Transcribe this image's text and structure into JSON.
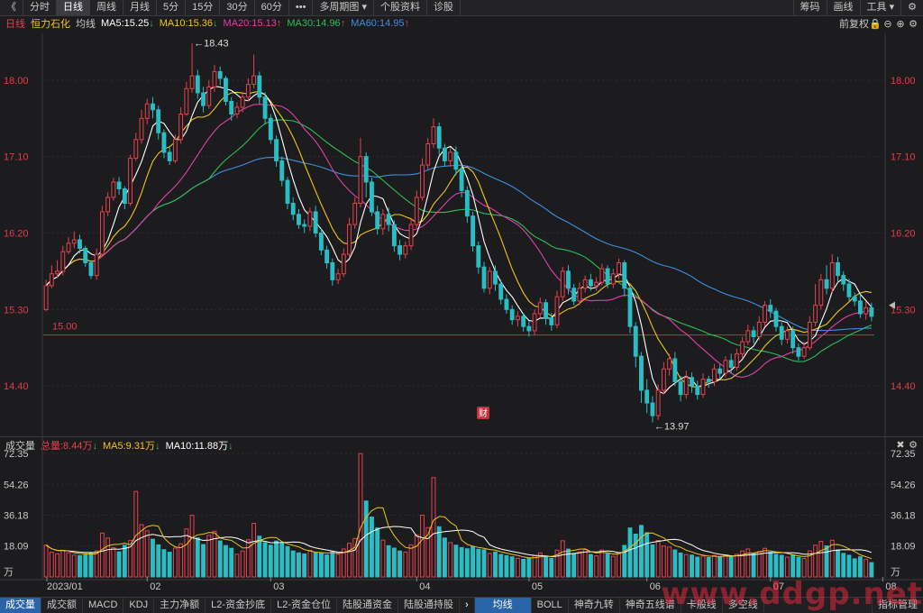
{
  "topbar": {
    "collapse_glyph": "《",
    "periods": [
      "分时",
      "日线",
      "周线",
      "月线",
      "5分",
      "15分",
      "30分",
      "60分"
    ],
    "active_period": 1,
    "more_glyph": "•••",
    "multi_period": "多周期图",
    "stock_info": "个股资料",
    "diagnose": "诊股",
    "chips": "筹码",
    "draw": "画线",
    "tools": "工具"
  },
  "ma_line": {
    "period": "日线",
    "stock": "恒力石化",
    "mode": "均线",
    "ma5": "MA5:15.25",
    "ma10": "MA10:15.36",
    "ma20": "MA20:15.13",
    "ma30": "MA30:14.96",
    "ma60": "MA60:14.95",
    "adjust": "前复权"
  },
  "price_axis": {
    "ticks": [
      "18.00",
      "17.10",
      "16.20",
      "15.30",
      "14.40"
    ],
    "high_label": "18.43",
    "low_label": "13.97",
    "ref_line_label": "15.00",
    "fin_marker": "财"
  },
  "volume_line": {
    "title": "成交量",
    "total": "总量:8.44万",
    "ma5": "MA5:9.31万",
    "ma10": "MA10:11.88万"
  },
  "volume_axis": {
    "ticks": [
      "72.35",
      "54.26",
      "36.18",
      "18.09"
    ],
    "unit": "万"
  },
  "x_axis": {
    "labels": [
      "2023/01",
      "02",
      "03",
      "04",
      "05",
      "06",
      "07",
      "08"
    ]
  },
  "bottom_tabs": {
    "left": [
      "成交量",
      "成交额",
      "MACD",
      "KDJ",
      "主力净额",
      "L2-资金抄底",
      "L2-资金仓位",
      "陆股通资金",
      "陆股通持股"
    ],
    "right": [
      "均线",
      "BOLL",
      "神奇九转",
      "神奇五线谱",
      "卡般线",
      "多空线"
    ],
    "manage": "指标管理",
    "active_left": 0,
    "active_right": 0
  },
  "watermark": "www.ddgp.net",
  "colors": {
    "up": "#e8404e",
    "down": "#2bbdc4",
    "ma5": "#ffffff",
    "ma10": "#f0c419",
    "ma20": "#e040a8",
    "ma30": "#2dbd5a",
    "ma60": "#3f8fe0",
    "ref_line": "#c0333d",
    "axis_text": "#e23c48"
  },
  "chart_data": {
    "type": "candlestick",
    "ylim": [
      13.85,
      18.55
    ],
    "volume_ylim": [
      0,
      72.35
    ],
    "volume_unit": "万",
    "reference_price": 15.0,
    "x_labels": [
      "2023/01",
      "02",
      "03",
      "04",
      "05",
      "06",
      "07",
      "08"
    ],
    "candles": [
      [
        15.3,
        15.58,
        15.65,
        15.28,
        18.6
      ],
      [
        15.58,
        15.72,
        15.82,
        15.55,
        14.5
      ],
      [
        15.72,
        15.75,
        15.88,
        15.67,
        13.5
      ],
      [
        15.75,
        15.98,
        16.05,
        15.7,
        15.6
      ],
      [
        15.98,
        16.08,
        16.15,
        15.95,
        14.2
      ],
      [
        16.08,
        16.12,
        16.22,
        16.02,
        12.8
      ],
      [
        16.12,
        16.02,
        16.18,
        15.96,
        12.5
      ],
      [
        16.02,
        15.85,
        16.05,
        15.8,
        13.0
      ],
      [
        15.85,
        15.7,
        15.88,
        15.66,
        14.2
      ],
      [
        15.7,
        15.95,
        16.02,
        15.65,
        15.3
      ],
      [
        15.95,
        16.45,
        16.52,
        15.92,
        25.7
      ],
      [
        16.45,
        16.62,
        16.68,
        16.4,
        22.8
      ],
      [
        16.62,
        16.8,
        16.85,
        16.58,
        17.1
      ],
      [
        16.8,
        16.72,
        16.86,
        16.65,
        14.7
      ],
      [
        16.72,
        16.55,
        16.75,
        16.48,
        18.6
      ],
      [
        16.55,
        17.08,
        17.12,
        16.52,
        21.3
      ],
      [
        17.08,
        17.3,
        17.38,
        17.05,
        50.1
      ],
      [
        17.3,
        17.55,
        17.65,
        17.25,
        30.6
      ],
      [
        17.55,
        17.72,
        17.78,
        17.48,
        27.0
      ],
      [
        17.72,
        17.65,
        17.8,
        17.55,
        22.1
      ],
      [
        17.65,
        17.38,
        17.7,
        17.3,
        18.8
      ],
      [
        17.38,
        17.15,
        17.42,
        17.08,
        16.0
      ],
      [
        17.15,
        17.05,
        17.22,
        17.0,
        14.5
      ],
      [
        17.05,
        17.3,
        17.36,
        17.02,
        16.9
      ],
      [
        17.3,
        17.6,
        17.68,
        17.25,
        19.4
      ],
      [
        17.6,
        17.9,
        17.98,
        17.58,
        28.1
      ],
      [
        17.9,
        18.05,
        18.43,
        17.85,
        36.1
      ],
      [
        18.05,
        17.85,
        18.12,
        17.78,
        22.9
      ],
      [
        17.85,
        17.7,
        17.92,
        17.62,
        19.0
      ],
      [
        17.7,
        17.92,
        18.0,
        17.66,
        24.4
      ],
      [
        17.92,
        18.1,
        18.18,
        17.86,
        26.8
      ],
      [
        18.1,
        18.02,
        18.16,
        17.94,
        21.1
      ],
      [
        18.02,
        17.75,
        18.05,
        17.7,
        18.4
      ],
      [
        17.75,
        17.6,
        17.8,
        17.52,
        16.8
      ],
      [
        17.6,
        17.68,
        17.74,
        17.55,
        13.3
      ],
      [
        17.68,
        17.8,
        17.86,
        17.62,
        15.2
      ],
      [
        17.8,
        17.95,
        18.02,
        17.75,
        21.8
      ],
      [
        17.95,
        18.05,
        18.3,
        17.9,
        31.4
      ],
      [
        18.05,
        17.8,
        18.1,
        17.72,
        23.9
      ],
      [
        17.8,
        17.55,
        17.86,
        17.48,
        20.1
      ],
      [
        17.55,
        17.3,
        17.6,
        17.25,
        18.6
      ],
      [
        17.3,
        17.05,
        17.35,
        16.98,
        21.0
      ],
      [
        17.05,
        16.82,
        17.1,
        16.75,
        19.8
      ],
      [
        16.82,
        16.55,
        16.86,
        16.48,
        17.8
      ],
      [
        16.55,
        16.42,
        16.62,
        16.35,
        15.2
      ],
      [
        16.42,
        16.3,
        16.48,
        16.25,
        14.1
      ],
      [
        16.3,
        16.28,
        16.36,
        16.2,
        13.5
      ],
      [
        16.28,
        16.45,
        16.5,
        16.22,
        15.6
      ],
      [
        16.45,
        16.2,
        16.52,
        16.15,
        14.2
      ],
      [
        16.2,
        16.0,
        16.25,
        15.94,
        13.8
      ],
      [
        16.0,
        15.85,
        16.05,
        15.78,
        12.9
      ],
      [
        15.85,
        15.65,
        15.9,
        15.58,
        14.7
      ],
      [
        15.65,
        15.72,
        15.78,
        15.6,
        13.3
      ],
      [
        15.72,
        15.95,
        16.02,
        15.68,
        16.4
      ],
      [
        15.95,
        16.3,
        16.38,
        15.92,
        19.7
      ],
      [
        16.3,
        16.55,
        16.62,
        16.25,
        22.5
      ],
      [
        16.55,
        17.1,
        17.32,
        16.5,
        72.3
      ],
      [
        17.1,
        16.8,
        17.15,
        16.62,
        44.5
      ],
      [
        16.8,
        16.45,
        16.85,
        16.4,
        35.1
      ],
      [
        16.45,
        16.25,
        16.52,
        16.18,
        28.7
      ],
      [
        16.25,
        16.42,
        16.48,
        16.18,
        21.6
      ],
      [
        16.42,
        16.3,
        16.5,
        16.22,
        18.3
      ],
      [
        16.3,
        16.05,
        16.35,
        15.98,
        16.9
      ],
      [
        16.05,
        15.95,
        16.12,
        15.88,
        15.2
      ],
      [
        15.95,
        16.05,
        16.1,
        15.9,
        14.6
      ],
      [
        16.05,
        16.3,
        16.38,
        16.0,
        18.8
      ],
      [
        16.3,
        16.62,
        16.7,
        16.26,
        24.6
      ],
      [
        16.62,
        17.0,
        17.08,
        16.58,
        36.2
      ],
      [
        17.0,
        17.25,
        17.32,
        16.95,
        28.9
      ],
      [
        17.25,
        17.45,
        17.55,
        17.2,
        58.2
      ],
      [
        17.45,
        17.2,
        17.5,
        17.12,
        29.4
      ],
      [
        17.2,
        17.05,
        17.25,
        16.98,
        22.8
      ],
      [
        17.05,
        17.15,
        17.2,
        16.98,
        20.1
      ],
      [
        17.15,
        16.95,
        17.22,
        16.88,
        18.6
      ],
      [
        16.95,
        16.7,
        17.0,
        16.62,
        17.2
      ],
      [
        16.7,
        16.4,
        16.75,
        16.32,
        16.5
      ],
      [
        16.4,
        16.05,
        16.45,
        15.98,
        17.8
      ],
      [
        16.05,
        15.8,
        16.1,
        15.72,
        16.2
      ],
      [
        15.8,
        15.55,
        15.86,
        15.5,
        15.9
      ],
      [
        15.55,
        15.75,
        15.8,
        15.48,
        13.8
      ],
      [
        15.75,
        15.6,
        15.82,
        15.52,
        14.6
      ],
      [
        15.6,
        15.42,
        15.65,
        15.36,
        13.2
      ],
      [
        15.42,
        15.3,
        15.48,
        15.25,
        12.5
      ],
      [
        15.3,
        15.18,
        15.35,
        15.12,
        11.8
      ],
      [
        15.18,
        15.22,
        15.28,
        15.1,
        10.9
      ],
      [
        15.22,
        15.1,
        15.26,
        15.04,
        10.3
      ],
      [
        15.1,
        15.05,
        15.16,
        14.98,
        10.8
      ],
      [
        15.05,
        15.25,
        15.3,
        15.0,
        12.5
      ],
      [
        15.25,
        15.38,
        15.44,
        15.2,
        14.1
      ],
      [
        15.38,
        15.2,
        15.42,
        15.12,
        11.7
      ],
      [
        15.2,
        15.12,
        15.26,
        15.05,
        10.9
      ],
      [
        15.12,
        15.45,
        15.52,
        15.08,
        15.7
      ],
      [
        15.45,
        15.75,
        15.8,
        15.4,
        21.2
      ],
      [
        15.75,
        15.55,
        15.82,
        15.48,
        16.3
      ],
      [
        15.55,
        15.4,
        15.6,
        15.35,
        13.8
      ],
      [
        15.4,
        15.55,
        15.62,
        15.35,
        14.7
      ],
      [
        15.55,
        15.65,
        15.7,
        15.5,
        16.1
      ],
      [
        15.65,
        15.58,
        15.72,
        15.52,
        13.2
      ],
      [
        15.58,
        15.62,
        15.68,
        15.52,
        12.4
      ],
      [
        15.62,
        15.78,
        15.84,
        15.58,
        15.8
      ],
      [
        15.78,
        15.6,
        15.82,
        15.55,
        13.6
      ],
      [
        15.6,
        15.72,
        15.78,
        15.55,
        12.1
      ],
      [
        15.72,
        15.85,
        15.9,
        15.66,
        14.3
      ],
      [
        15.85,
        15.55,
        15.88,
        15.45,
        18.5
      ],
      [
        15.55,
        15.1,
        15.58,
        15.02,
        28.7
      ],
      [
        15.1,
        14.75,
        15.15,
        14.62,
        25.1
      ],
      [
        14.75,
        14.35,
        14.8,
        14.2,
        30.2
      ],
      [
        14.35,
        14.2,
        14.48,
        14.08,
        25.9
      ],
      [
        14.2,
        14.05,
        14.28,
        13.97,
        18.8
      ],
      [
        14.05,
        14.35,
        14.42,
        14.0,
        21.4
      ],
      [
        14.35,
        14.6,
        14.68,
        14.3,
        18.1
      ],
      [
        14.6,
        14.72,
        14.78,
        14.52,
        17.5
      ],
      [
        14.72,
        14.45,
        14.8,
        14.4,
        15.8
      ],
      [
        14.45,
        14.3,
        14.52,
        14.22,
        14.0
      ],
      [
        14.3,
        14.5,
        14.58,
        14.25,
        13.1
      ],
      [
        14.5,
        14.4,
        14.56,
        14.32,
        12.8
      ],
      [
        14.4,
        14.3,
        14.46,
        14.24,
        11.6
      ],
      [
        14.3,
        14.48,
        14.55,
        14.26,
        12.2
      ],
      [
        14.48,
        14.45,
        14.52,
        14.38,
        11.4
      ],
      [
        14.45,
        14.6,
        14.66,
        14.4,
        12.6
      ],
      [
        14.6,
        14.55,
        14.66,
        14.48,
        11.8
      ],
      [
        14.55,
        14.7,
        14.75,
        14.5,
        12.9
      ],
      [
        14.7,
        14.62,
        14.78,
        14.55,
        11.7
      ],
      [
        14.62,
        14.78,
        14.84,
        14.58,
        13.3
      ],
      [
        14.78,
        14.92,
        14.98,
        14.72,
        15.2
      ],
      [
        14.92,
        15.05,
        15.12,
        14.88,
        16.4
      ],
      [
        15.05,
        14.98,
        15.1,
        14.9,
        13.7
      ],
      [
        14.98,
        15.15,
        15.22,
        14.94,
        14.9
      ],
      [
        15.15,
        15.35,
        15.4,
        15.1,
        16.8
      ],
      [
        15.35,
        15.28,
        15.42,
        15.2,
        14.5
      ],
      [
        15.28,
        15.1,
        15.32,
        15.04,
        13.2
      ],
      [
        15.1,
        14.95,
        15.15,
        14.88,
        12.7
      ],
      [
        14.95,
        15.05,
        15.1,
        14.9,
        11.6
      ],
      [
        15.05,
        14.85,
        15.1,
        14.78,
        12.9
      ],
      [
        14.85,
        14.75,
        14.9,
        14.7,
        11.5
      ],
      [
        14.75,
        14.85,
        14.92,
        14.72,
        10.8
      ],
      [
        14.85,
        15.15,
        15.22,
        14.82,
        15.3
      ],
      [
        15.15,
        15.35,
        15.6,
        15.1,
        18.6
      ],
      [
        15.35,
        15.65,
        15.72,
        15.3,
        20.8
      ],
      [
        15.65,
        15.55,
        15.82,
        15.48,
        18.2
      ],
      [
        15.55,
        15.85,
        15.95,
        15.5,
        21.5
      ],
      [
        15.85,
        15.7,
        15.92,
        15.62,
        15.9
      ],
      [
        15.7,
        15.6,
        15.75,
        15.52,
        13.8
      ],
      [
        15.6,
        15.45,
        15.66,
        15.4,
        12.7
      ],
      [
        15.45,
        15.4,
        15.5,
        15.34,
        10.6
      ],
      [
        15.4,
        15.25,
        15.48,
        15.2,
        11.8
      ],
      [
        15.25,
        15.32,
        15.4,
        15.18,
        10.2
      ],
      [
        15.32,
        15.22,
        15.38,
        15.16,
        8.4
      ]
    ]
  }
}
